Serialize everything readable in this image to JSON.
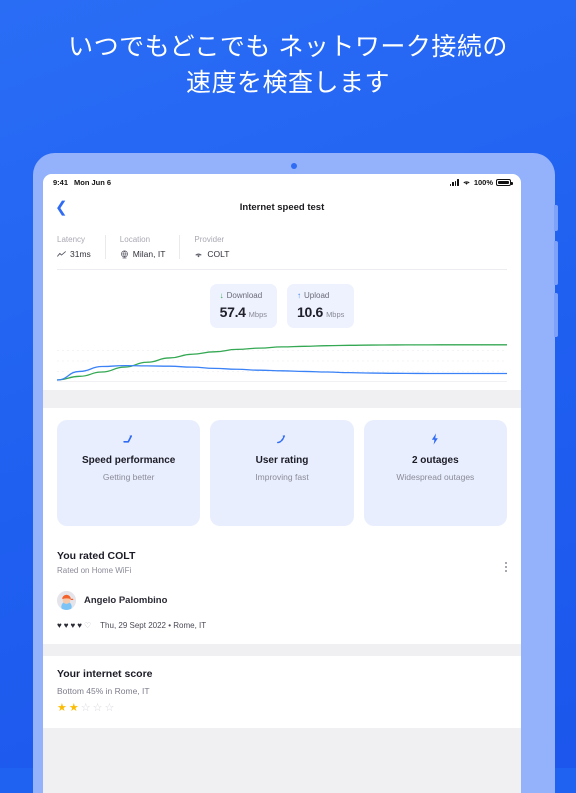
{
  "promo": {
    "headline_line_1": "いつでもどこでも ネットワーク接続の",
    "headline_line_2": "速度を検査します",
    "background_color": "#1f62f2"
  },
  "status_bar": {
    "time": "9:41",
    "date": "Mon Jun 6",
    "battery_percent": "100%",
    "signal_icon": "cellular-bars-icon",
    "wifi_icon": "wifi-icon",
    "battery_icon": "battery-icon"
  },
  "nav": {
    "back_icon": "chevron-left-icon",
    "title": "Internet speed test"
  },
  "meta": {
    "items": [
      {
        "label": "Latency",
        "value": "31ms",
        "icon": "trend-line-icon"
      },
      {
        "label": "Location",
        "value": "Milan, IT",
        "icon": "globe-icon"
      },
      {
        "label": "Provider",
        "value": "COLT",
        "icon": "wifi-icon"
      }
    ]
  },
  "speed": {
    "cards": [
      {
        "label": "Download",
        "arrow": "↓",
        "direction": "down",
        "value": "57.4",
        "unit": "Mbps",
        "color": "#34a853"
      },
      {
        "label": "Upload",
        "arrow": "↑",
        "direction": "up",
        "value": "10.6",
        "unit": "Mbps",
        "color": "#3b82f6"
      }
    ]
  },
  "chart_data": {
    "type": "line",
    "title": "",
    "xlabel": "",
    "ylabel": "",
    "grid": true,
    "legend": "none",
    "xlim": [
      0,
      100
    ],
    "ylim": [
      0,
      62
    ],
    "series": [
      {
        "name": "Download",
        "color": "#34a853",
        "values": [
          0,
          6,
          13,
          21,
          29,
          36,
          42,
          46,
          50,
          52,
          54,
          55,
          56,
          56.6,
          57,
          57.2,
          57.3,
          57.4,
          57.4,
          57.4,
          57.4
        ]
      },
      {
        "name": "Upload",
        "color": "#3b82f6",
        "values": [
          0,
          14,
          22,
          23.5,
          23,
          22.5,
          21,
          19,
          17.5,
          16,
          15,
          14,
          13,
          12,
          11.3,
          10.9,
          10.7,
          10.6,
          10.6,
          10.6,
          10.6
        ]
      }
    ]
  },
  "info_cards": [
    {
      "icon": "trending-up-icon",
      "title": "Speed performance",
      "subtitle": "Getting better"
    },
    {
      "icon": "trending-up-icon",
      "title": "User rating",
      "subtitle": "Improving fast"
    },
    {
      "icon": "lightning-bolt-icon",
      "title": "2 outages",
      "subtitle": "Widespread outages"
    }
  ],
  "rating": {
    "title": "You rated COLT",
    "subtitle": "Rated on Home WiFi",
    "menu_icon": "kebab-menu-icon",
    "reviewer_name": "Angelo Palombino",
    "avatar_icon": "user-avatar-icon",
    "hearts_filled": 4,
    "hearts_total": 5,
    "date_location": "Thu, 29 Sept 2022 • Rome, IT"
  },
  "score": {
    "title": "Your internet score",
    "subtitle": "Bottom 45% in Rome, IT",
    "stars_filled": 2,
    "stars_total": 5,
    "star_color": "#fbbc04"
  }
}
